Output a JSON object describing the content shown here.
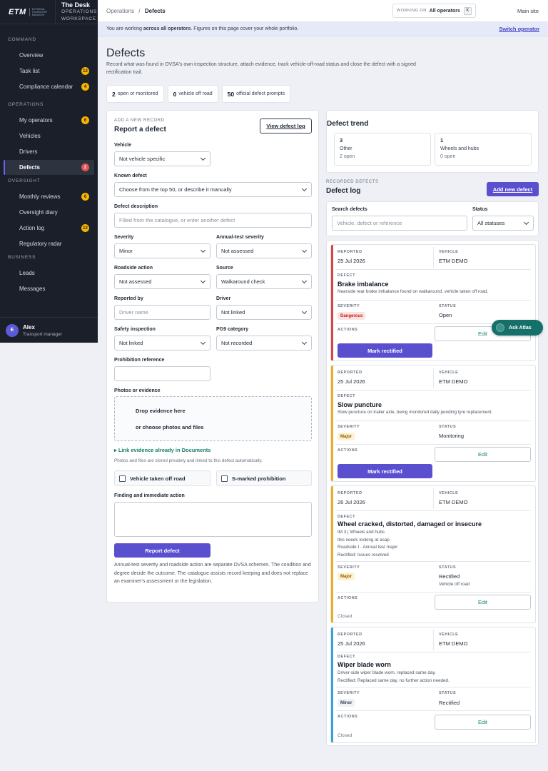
{
  "brand": {
    "logo": "ETM",
    "logo_sub": "EXTERNAL TRANSPORT MANAGER",
    "title": "The Desk",
    "subtitle_1": "OPERATIONS",
    "subtitle_2": "WORKSPACE"
  },
  "sidebar": {
    "sections": [
      {
        "label": "COMMAND",
        "items": [
          {
            "label": "Overview"
          },
          {
            "label": "Task list",
            "badge": "12"
          },
          {
            "label": "Compliance calendar",
            "badge": "4"
          }
        ]
      },
      {
        "label": "OPERATIONS",
        "items": [
          {
            "label": "My operators",
            "badge": "6"
          },
          {
            "label": "Vehicles"
          },
          {
            "label": "Drivers"
          },
          {
            "label": "Defects",
            "badge": "2",
            "active": true
          }
        ]
      },
      {
        "label": "OVERSIGHT",
        "items": [
          {
            "label": "Monthly reviews",
            "badge": "6"
          },
          {
            "label": "Oversight diary"
          },
          {
            "label": "Action log",
            "badge": "12"
          },
          {
            "label": "Regulatory radar"
          }
        ]
      },
      {
        "label": "BUSINESS",
        "items": [
          {
            "label": "Leads"
          },
          {
            "label": "Messages"
          }
        ]
      }
    ],
    "user": {
      "initial": "E",
      "name": "Alex",
      "role": "Transport manager"
    }
  },
  "topbar": {
    "crumb_parent": "Operations",
    "crumb_sep": "/",
    "crumb_current": "Defects",
    "working_label": "WORKING ON",
    "working_value": "All operators",
    "working_key": "K",
    "main_site": "Main site"
  },
  "banner": {
    "text_pre": "You are working ",
    "text_bold": "across all operators",
    "text_post": ". Figures on this page cover your whole portfolio.",
    "link": "Switch operator"
  },
  "page": {
    "title": "Defects",
    "description": "Record what was found in DVSA's own inspection structure, attach evidence, track vehicle-off-road status and close the defect with a signed rectification trail."
  },
  "stats": [
    {
      "value": "2",
      "label": "open or monitored"
    },
    {
      "value": "0",
      "label": "vehicle off road"
    },
    {
      "value": "50",
      "label": "official defect prompts"
    }
  ],
  "form": {
    "kicker": "ADD A NEW RECORD",
    "title": "Report a defect",
    "view_log": "View defect log",
    "vehicle_label": "Vehicle",
    "vehicle_value": "Not vehicle specific",
    "known_label": "Known defect",
    "known_value": "Choose from the top 50, or describe it manually",
    "desc_label": "Defect description",
    "desc_placeholder": "Filled from the catalogue, or enter another defect",
    "severity_label": "Severity",
    "severity_value": "Minor",
    "annual_label": "Annual-test severity",
    "annual_value": "Not assessed",
    "roadside_label": "Roadside action",
    "roadside_value": "Not assessed",
    "source_label": "Source",
    "source_value": "Walkaround check",
    "reported_label": "Reported by",
    "reported_placeholder": "Driver name",
    "driver_label": "Driver",
    "driver_value": "Not linked",
    "safety_label": "Safety inspection",
    "safety_value": "Not linked",
    "pg9_label": "PG9 category",
    "pg9_value": "Not recorded",
    "prohibition_label": "Prohibition reference",
    "photos_label": "Photos or evidence",
    "drop_text": "Drop evidence here",
    "choose_text": "or choose photos and files",
    "link_evidence": "▸ Link evidence already in Documents",
    "storage_note": "Photos and files are stored privately and linked to this defect automatically.",
    "vor_label": "Vehicle taken off road",
    "smarked_label": "S-marked prohibition",
    "finding_label": "Finding and immediate action",
    "submit": "Report defect",
    "footnote": "Annual-test severity and roadside action are separate DVSA schemes. The condition and degree decide the outcome. The catalogue assists record keeping and does not replace an examiner's assessment or the legislation."
  },
  "trend": {
    "title": "Defect trend",
    "cards": [
      {
        "count": "3",
        "category": "Other",
        "open": "2 open"
      },
      {
        "count": "1",
        "category": "Wheels and hubs",
        "open": "0 open"
      }
    ]
  },
  "log": {
    "kicker": "RECORDED DEFECTS",
    "title": "Defect log",
    "add_button": "Add new defect",
    "search_label": "Search defects",
    "search_placeholder": "Vehicle, defect or reference",
    "status_label": "Status",
    "status_value": "All statuses",
    "labels": {
      "reported": "REPORTED",
      "vehicle": "VEHICLE",
      "defect": "DEFECT",
      "severity": "SEVERITY",
      "status": "STATUS",
      "actions": "ACTIONS",
      "edit": "Edit",
      "mark": "Mark rectified"
    },
    "cards": [
      {
        "reported": "25 Jul 2026",
        "vehicle": "ETM DEMO",
        "title": "Brake imbalance",
        "lines": [
          "Nearside rear brake imbalance found on walkaround, vehicle taken off road."
        ],
        "severity": "Dangerous",
        "status": "Open"
      },
      {
        "reported": "25 Jul 2026",
        "vehicle": "ETM DEMO",
        "title": "Slow puncture",
        "lines": [
          "Slow puncture on trailer axle, being monitored daily pending tyre replacement."
        ],
        "severity": "Major",
        "status": "Monitoring"
      },
      {
        "reported": "26 Jul 2026",
        "vehicle": "ETM DEMO",
        "title": "Wheel cracked, distorted, damaged or insecure",
        "lines": [
          "IM 3 | Wheels and hubs",
          "this needs looking at asap",
          "Roadside I · Annual test major",
          "Rectified: Issues resolved"
        ],
        "severity": "Major",
        "status": "Rectified",
        "status_sub": "Vehicle off road",
        "closed": "Closed"
      },
      {
        "reported": "25 Jul 2026",
        "vehicle": "ETM DEMO",
        "title": "Wiper blade worn",
        "lines": [
          "Driver-side wiper blade worn, replaced same day.",
          "Rectified: Replaced same day, no further action needed."
        ],
        "severity": "Minor",
        "status": "Rectified",
        "closed": "Closed"
      }
    ]
  },
  "atlas": {
    "label": "Ask Atlas"
  },
  "colors": {
    "accent": "#5a4fcf",
    "sidebar": "#1b1f2a",
    "dangerous": "#d64545",
    "major": "#e8b020",
    "minor": "#3aa0d8",
    "teal": "#16706a"
  }
}
